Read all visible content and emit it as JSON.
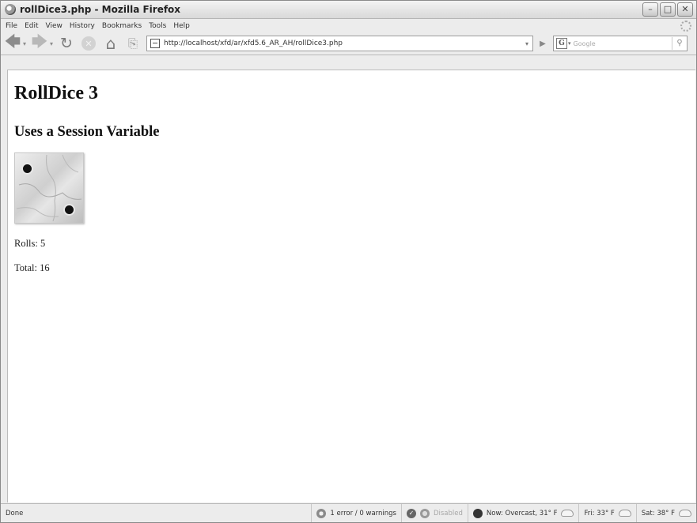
{
  "window": {
    "title": "rollDice3.php - Mozilla Firefox"
  },
  "menu": [
    "File",
    "Edit",
    "View",
    "History",
    "Bookmarks",
    "Tools",
    "Help"
  ],
  "nav": {
    "url": "http://localhost/xfd/ar/xfd5.6_AR_AH/rollDice3.php"
  },
  "search": {
    "placeholder": "Google",
    "engine": "G"
  },
  "page": {
    "heading": "RollDice 3",
    "subheading": "Uses a Session Variable",
    "rolls": "Rolls: 5",
    "total": "Total: 16"
  },
  "status": {
    "text": "Done",
    "errors": "1 error / 0 warnings",
    "addon": "Disabled",
    "weather_now": "Now: Overcast, 31° F",
    "weather_fri": "Fri: 33° F",
    "weather_sat": "Sat: 38° F"
  },
  "icons": [
    "firefox-icon",
    "back-icon",
    "forward-icon",
    "reload-icon",
    "stop-icon",
    "home-icon",
    "bookmark-icon",
    "page-icon",
    "go-icon",
    "search-icon",
    "error-icon",
    "weather-icon",
    "cloud-icon"
  ]
}
